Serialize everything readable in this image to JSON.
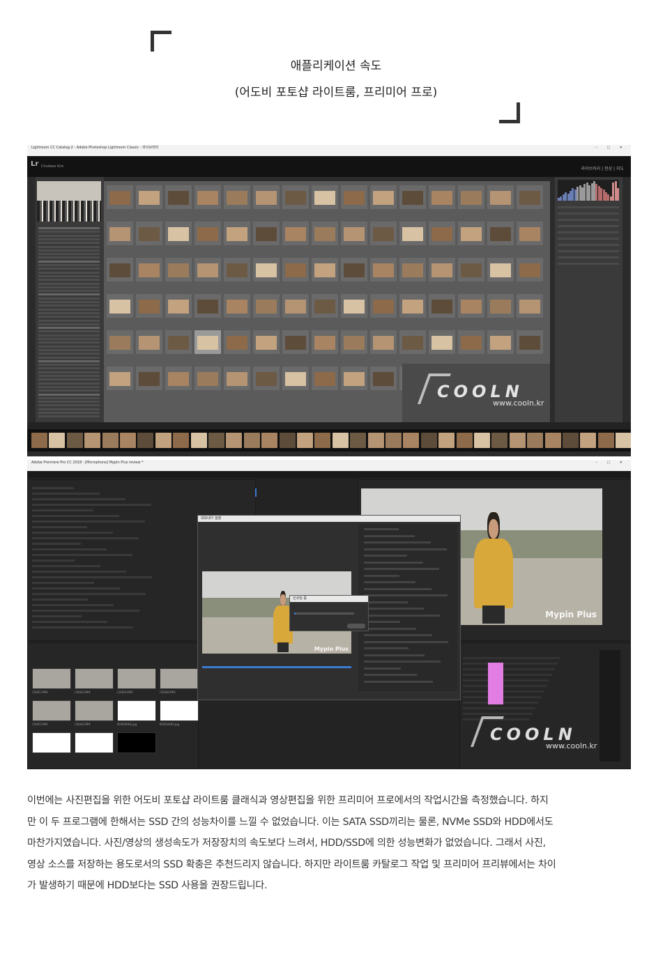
{
  "heading": {
    "line1": "애플리케이션 속도",
    "line2": "(어도비 포토샵 라이트룸, 프리미어 프로)"
  },
  "lightroom": {
    "window_title": "Lightroom CC Catalog-2 - Adobe Photoshop Lightroom Classic - 라이브러리",
    "logo": "Lr",
    "user": "Chulwoo Kim",
    "modules": "라이브러리 | 현상 | 지도",
    "watermark_brand": "COOLN",
    "watermark_url": "www.cooln.kr"
  },
  "premiere": {
    "window_title": "Adobe Premiere Pro CC 2018 - [Microphone] Mypin Plus review *",
    "export_dialog_title": "내보내기 설정",
    "progress_dialog_title": "인코딩 중",
    "video_overlay": "Mypin Plus",
    "watermark_brand": "COOLN",
    "watermark_url": "www.cooln.kr",
    "bin_items": [
      "C0001.MP4",
      "C0002.MP4",
      "C0004.MP4",
      "C0008.MP4",
      "C0045.MP4",
      "C0046.MP4",
      "KO950004.jpg",
      "KO950003.jpg"
    ]
  },
  "body": {
    "lines": [
      " 이번에는 사진편집을 위한 어도비 포토샵 라이트룸 클래식과 영상편집을 위한 프리미어 프로에서의 작업시간을 측정했습니다. 하지",
      "만 이 두 프로그램에 한해서는 SSD 간의 성능차이를 느낄 수 없었습니다. 이는 SATA SSD끼리는 물론, NVMe SSD와 HDD에서도",
      "마찬가지였습니다. 사진/영상의 생성속도가 저장장치의 속도보다 느려서, HDD/SSD에 의한 성능변화가 없었습니다. 그래서 사진,",
      "영상 소스를 저장하는 용도로서의 SSD 확충은 추천드리지 않습니다. 하지만 라이트룸 카탈로그 작업 및 프리미어 프리뷰에서는 차이",
      "가 발생하기 때문에 HDD보다는 SSD 사용을 권장드립니다."
    ]
  }
}
